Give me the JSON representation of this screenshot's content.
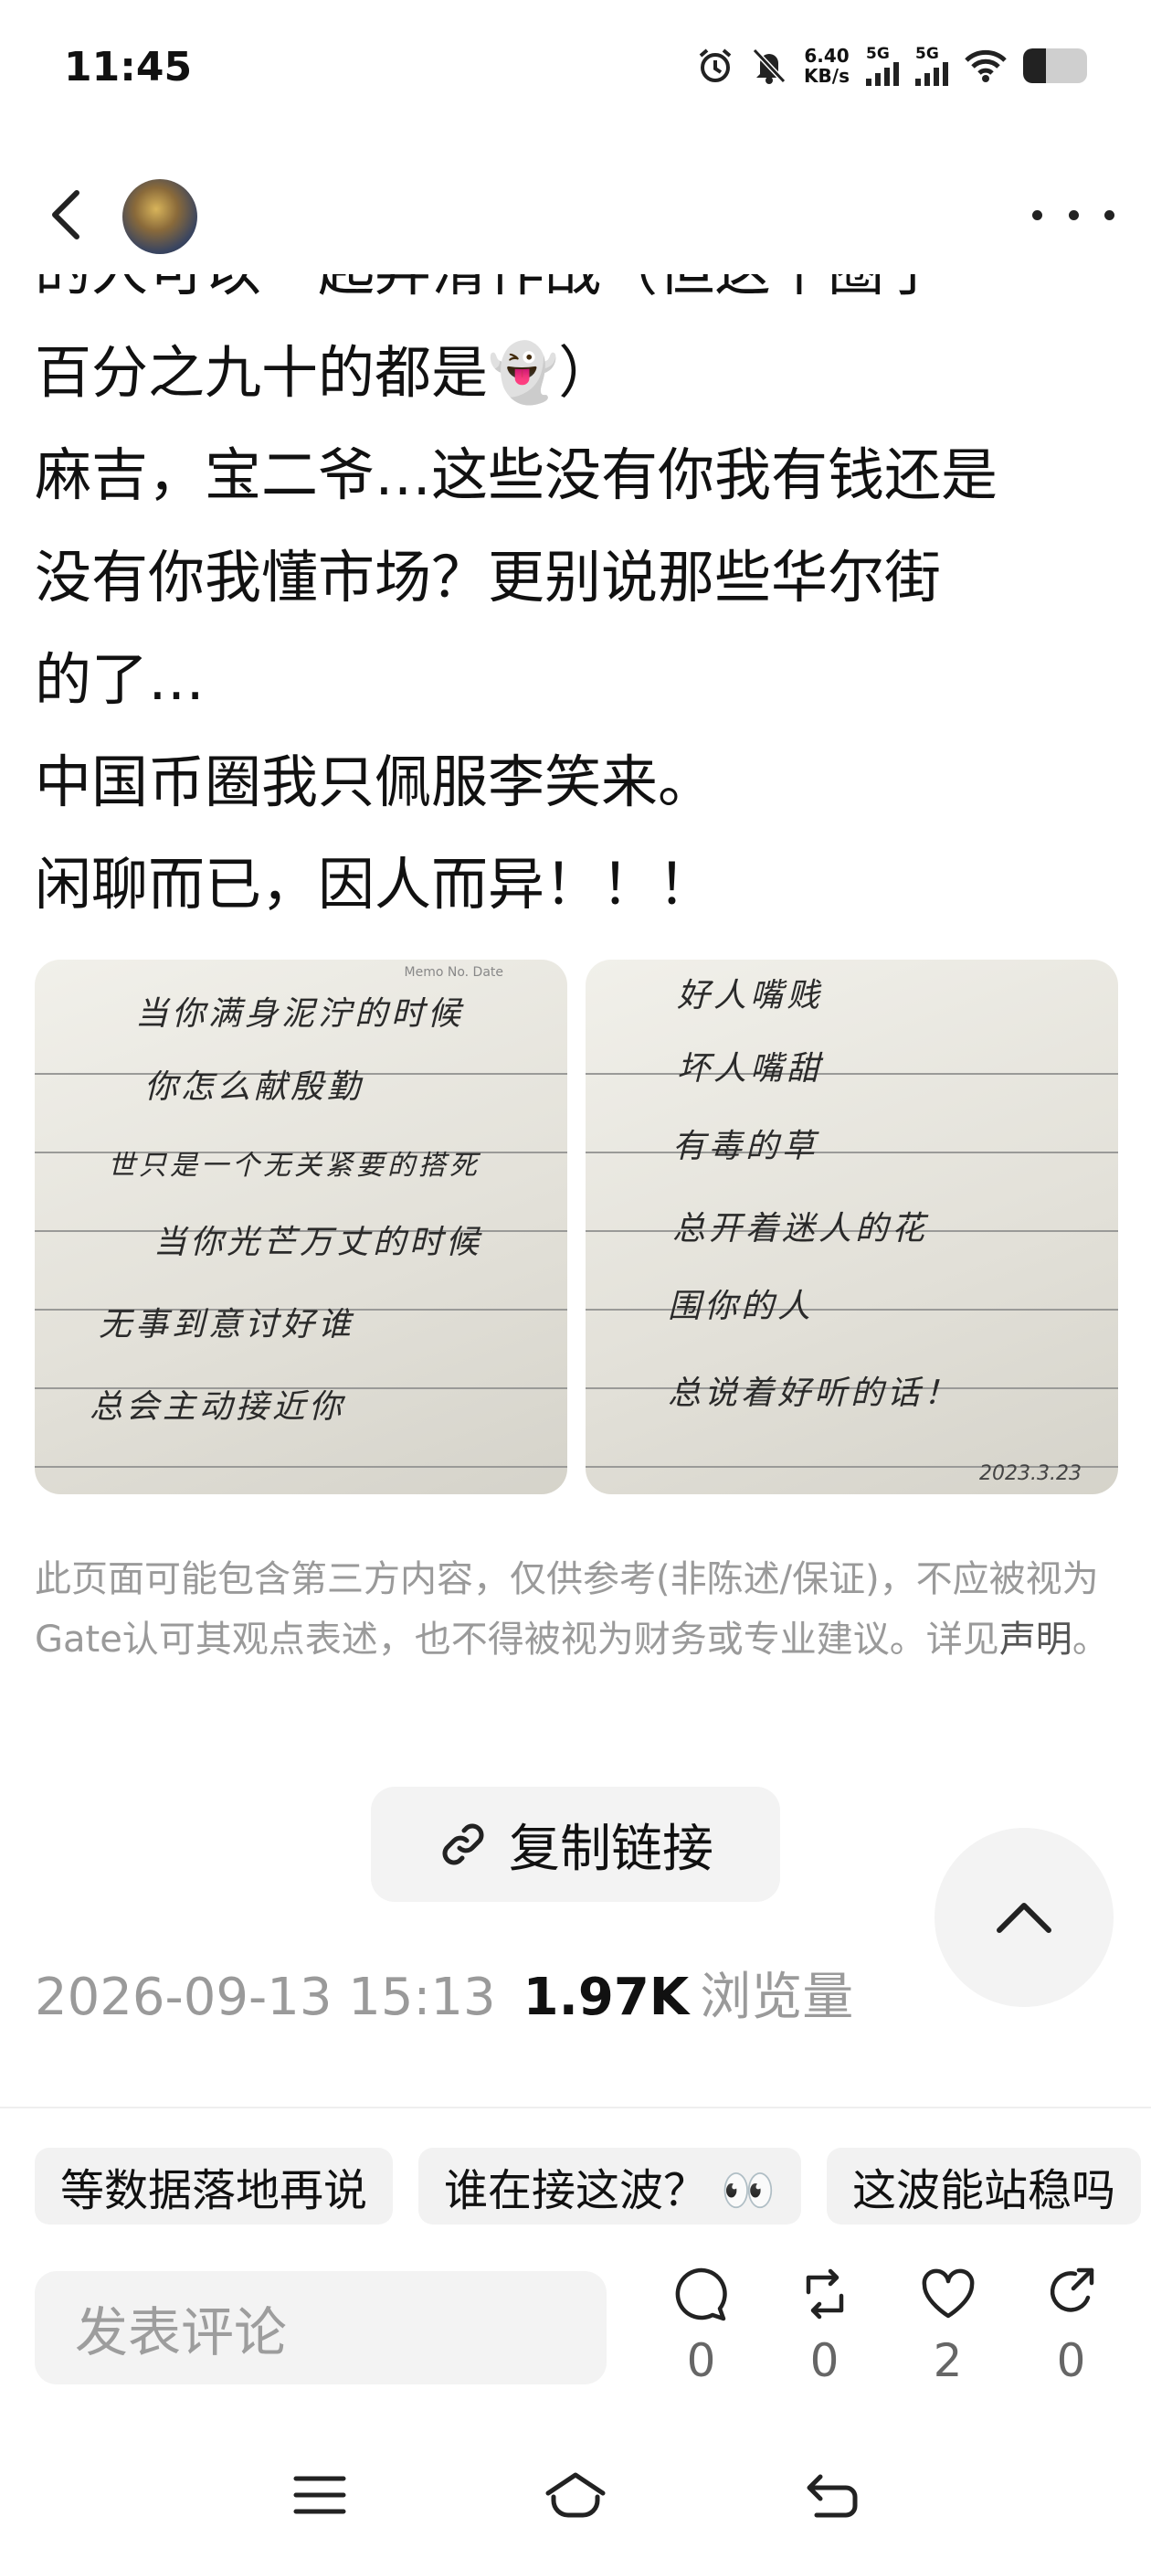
{
  "status_bar": {
    "time": "11:45",
    "net_speed_value": "6.40",
    "net_speed_unit": "KB/s",
    "signal_1": "5G",
    "signal_2": "5G",
    "battery_level": 0.35,
    "icons": [
      "alarm-icon",
      "mute-icon",
      "wifi-icon",
      "battery-icon"
    ]
  },
  "header": {
    "back_icon": "chevron-left-icon",
    "more_icon": "more-dots-icon"
  },
  "article": {
    "lines": [
      "的人可以一起弄滑作战（但这个圈子",
      "百分之九十的都是👻）",
      "麻吉，宝二爷…这些没有你我有钱还是",
      "没有你我懂市场？更别说那些华尔街",
      "的了…",
      "中国币圈我只佩服李笑来。",
      "闲聊而已，因人而异！！！"
    ]
  },
  "images": {
    "left": {
      "header_text": "Memo No. Date",
      "lines": [
        "当你满身泥泞的时候",
        "你怎么献殷勤",
        "世只是一个无关紧要的搭死",
        "当你光芒万丈的时候",
        "无事到意讨好谁",
        "总会主动接近你"
      ]
    },
    "right": {
      "lines": [
        "好人嘴贱",
        "坏人嘴甜",
        "有毒的草",
        "总开着迷人的花",
        "围你的人",
        "总说着好听的话！"
      ],
      "signature": "2023.3.23"
    }
  },
  "disclaimer": {
    "text": "此页面可能包含第三方内容，仅供参考(非陈述/保证)，不应被视为Gate认可其观点表述，也不得被视为财务或专业建议。详见",
    "link": "声明",
    "end": "。"
  },
  "copy_link": {
    "label": "复制链接",
    "icon": "link-icon"
  },
  "meta": {
    "datetime": "2026-09-13 15:13",
    "views_count": "1.97K",
    "views_label": "浏览量"
  },
  "quick_replies": [
    "等数据落地再说",
    "谁在接这波？ 👀",
    "这波能站稳吗"
  ],
  "comment": {
    "placeholder": "发表评论"
  },
  "actions": [
    {
      "icon": "comment-icon",
      "count": "0"
    },
    {
      "icon": "repost-icon",
      "count": "0"
    },
    {
      "icon": "heart-icon",
      "count": "2"
    },
    {
      "icon": "share-icon",
      "count": "0"
    }
  ],
  "colors": {
    "text": "#111111",
    "muted": "#9a9a9a",
    "chip_bg": "#f2f2f2"
  }
}
